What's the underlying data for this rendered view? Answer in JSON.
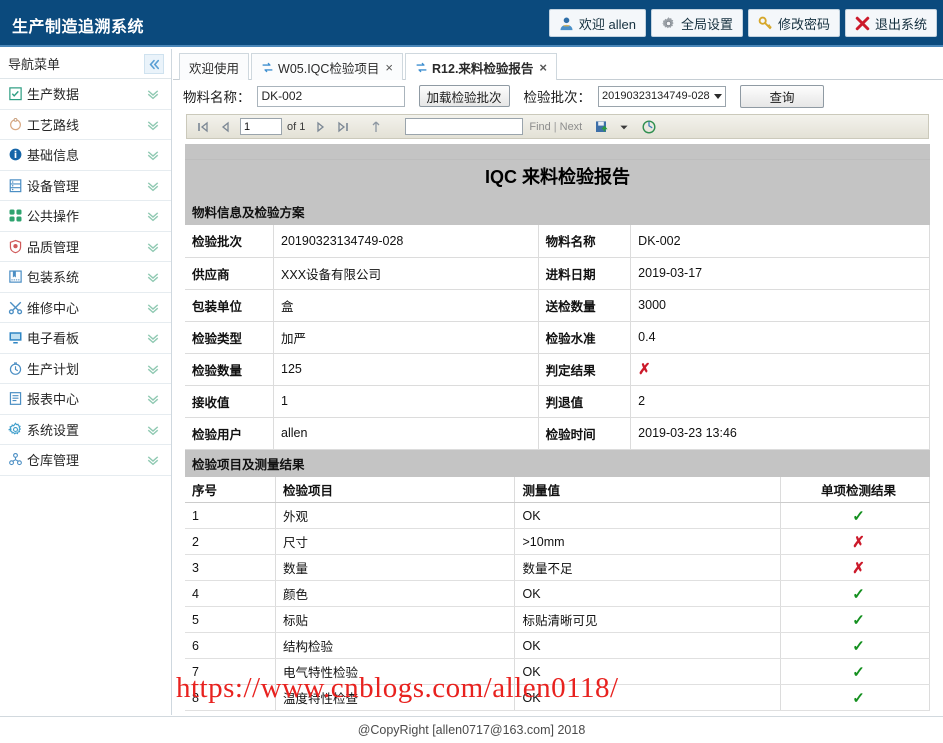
{
  "header": {
    "title": "生产制造追溯系统",
    "buttons": [
      {
        "label": "欢迎 allen",
        "icon": "user-icon"
      },
      {
        "label": "全局设置",
        "icon": "gear-icon"
      },
      {
        "label": "修改密码",
        "icon": "key-icon"
      },
      {
        "label": "退出系统",
        "icon": "exit-x-icon"
      }
    ]
  },
  "sidebar": {
    "title": "导航菜单",
    "collapse_icon": "double-chevron-left-icon",
    "items": [
      {
        "label": "生产数据",
        "icon": "clipboard-check-icon"
      },
      {
        "label": "工艺路线",
        "icon": "route-circle-icon"
      },
      {
        "label": "基础信息",
        "icon": "info-circle-icon"
      },
      {
        "label": "设备管理",
        "icon": "server-rack-icon"
      },
      {
        "label": "公共操作",
        "icon": "clover-grid-icon"
      },
      {
        "label": "品质管理",
        "icon": "shield-badge-icon"
      },
      {
        "label": "包装系统",
        "icon": "package-box-icon"
      },
      {
        "label": "维修中心",
        "icon": "wrench-scissors-icon"
      },
      {
        "label": "电子看板",
        "icon": "monitor-board-icon"
      },
      {
        "label": "生产计划",
        "icon": "clock-plan-icon"
      },
      {
        "label": "报表中心",
        "icon": "report-list-icon"
      },
      {
        "label": "系统设置",
        "icon": "settings-gear-icon"
      },
      {
        "label": "仓库管理",
        "icon": "warehouse-nodes-icon"
      }
    ]
  },
  "tabs": [
    {
      "label": "欢迎使用",
      "icon": null,
      "closable": false,
      "active": false
    },
    {
      "label": "W05.IQC检验项目",
      "icon": "refresh-arrows-icon",
      "closable": true,
      "active": false
    },
    {
      "label": "R12.来料检验报告",
      "icon": "refresh-arrows-icon",
      "closable": true,
      "active": true
    }
  ],
  "query_bar": {
    "material_label": "物料名称：",
    "material_value": "DK-002",
    "material_placeholder": "",
    "load_batch_label": "加载检验批次",
    "batch_label": "检验批次：",
    "batch_selected": "20190323134749-028",
    "batch_options": [
      "20190323134749-028"
    ],
    "search_label": "查询"
  },
  "report_toolbar": {
    "first_icon": "first-page-icon",
    "prev_icon": "prev-page-icon",
    "page_value": "1",
    "page_total": "of 1",
    "next_icon": "next-page-icon",
    "last_icon": "last-page-icon",
    "back_icon": "back-to-parent-icon",
    "find_value": "",
    "find_placeholder": "",
    "find_label": "Find",
    "separator": "|",
    "next_label": "Next",
    "export_icon": "export-save-icon",
    "refresh_icon": "refresh-icon"
  },
  "report": {
    "title": "IQC 来料检验报告",
    "section_info": "物料信息及检验方案",
    "section_items": "检验项目及测量结果",
    "info_rows": [
      {
        "k1": "检验批次",
        "v1": "20190323134749-028",
        "k2": "物料名称",
        "v2": "DK-002",
        "v2_mark": null
      },
      {
        "k1": "供应商",
        "v1": "XXX设备有限公司",
        "k2": "进料日期",
        "v2": "2019-03-17",
        "v2_mark": null
      },
      {
        "k1": "包装单位",
        "v1": "盒",
        "k2": "送检数量",
        "v2": "3000",
        "v2_mark": null
      },
      {
        "k1": "检验类型",
        "v1": "加严",
        "k2": "检验水准",
        "v2": "0.4",
        "v2_mark": null
      },
      {
        "k1": "检验数量",
        "v1": "125",
        "k2": "判定结果",
        "v2": "",
        "v2_mark": "fail"
      },
      {
        "k1": "接收值",
        "v1": "1",
        "k2": "判退值",
        "v2": "2",
        "v2_mark": null
      },
      {
        "k1": "检验用户",
        "v1": "allen",
        "k2": "检验时间",
        "v2": "2019-03-23 13:46",
        "v2_mark": null
      }
    ],
    "item_columns": [
      "序号",
      "检验项目",
      "测量值",
      "单项检测结果"
    ],
    "item_rows": [
      {
        "no": "1",
        "item": "外观",
        "value": "OK",
        "result": "ok"
      },
      {
        "no": "2",
        "item": "尺寸",
        "value": ">10mm",
        "result": "fail"
      },
      {
        "no": "3",
        "item": "数量",
        "value": "数量不足",
        "result": "fail"
      },
      {
        "no": "4",
        "item": "颜色",
        "value": "OK",
        "result": "ok"
      },
      {
        "no": "5",
        "item": "标贴",
        "value": "标贴清晰可见",
        "result": "ok"
      },
      {
        "no": "6",
        "item": "结构检验",
        "value": "OK",
        "result": "ok"
      },
      {
        "no": "7",
        "item": "电气特性检验",
        "value": "OK",
        "result": "ok"
      },
      {
        "no": "8",
        "item": "温度特性检查",
        "value": "OK",
        "result": "ok"
      }
    ]
  },
  "watermark": "https://www.cnblogs.com/allen0118/",
  "footer": {
    "text": "@CopyRight [allen0717@163.com] 2018"
  },
  "marks": {
    "ok": "✓",
    "fail": "✗"
  },
  "colors": {
    "header_bg": "#0b4a7d",
    "header_rule": "#4a86b8",
    "section_bg": "#c4c4c4",
    "ok_green": "#14901f",
    "fail_red": "#cc1a2b",
    "watermark_red": "#e8221f"
  }
}
